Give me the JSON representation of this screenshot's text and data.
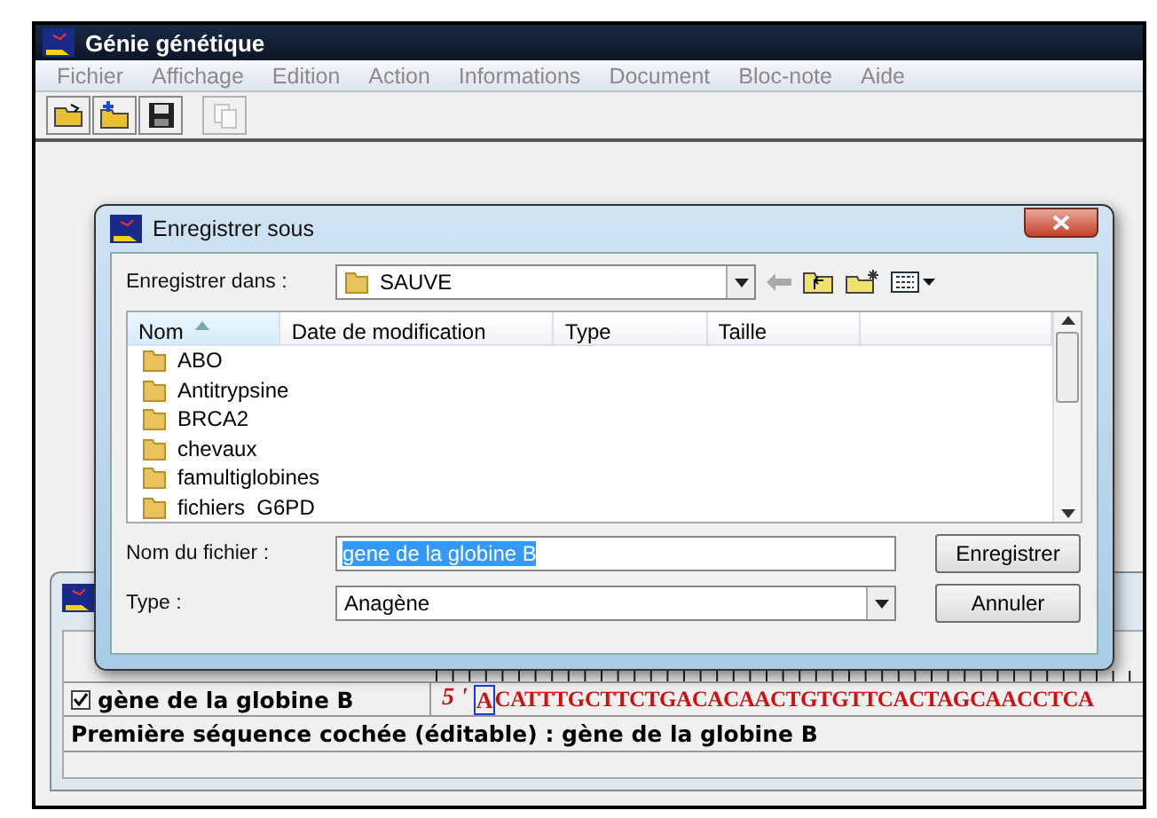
{
  "window": {
    "title": "Génie génétique"
  },
  "menu": [
    "Fichier",
    "Affichage",
    "Edition",
    "Action",
    "Informations",
    "Document",
    "Bloc-note",
    "Aide"
  ],
  "toolbar": [
    {
      "kind": "open",
      "disabled": false
    },
    {
      "kind": "new-folder",
      "disabled": false
    },
    {
      "kind": "save",
      "disabled": false
    },
    {
      "kind": "copy",
      "disabled": true
    }
  ],
  "sequence_row": {
    "checked": true,
    "name": "gène de la globine B",
    "prime": "5 '",
    "cursor_base": "A",
    "sequence": "CATTTGCTTCTGACACAACTGTGTTCACTAGCAACCTCA"
  },
  "status": "Première séquence cochée (éditable) : gène de la globine B",
  "dialog": {
    "title": "Enregistrer sous",
    "location_label": "Enregistrer dans :",
    "location": "SAUVE",
    "columns": [
      {
        "label": "Nom",
        "sorted": true
      },
      {
        "label": "Date de modification",
        "sorted": false
      },
      {
        "label": "Type",
        "sorted": false
      },
      {
        "label": "Taille",
        "sorted": false
      }
    ],
    "folders": [
      "ABO",
      "Antitrypsine",
      "BRCA2",
      "chevaux",
      "famultiglobines",
      "fichiers  G6PD"
    ],
    "filename_label": "Nom du fichier :",
    "filename": {
      "value": "gene de la globine B",
      "highlighted": true
    },
    "type_label": "Type :",
    "type": "Anagène",
    "buttons": [
      "Enregistrer",
      "Annuler"
    ]
  }
}
